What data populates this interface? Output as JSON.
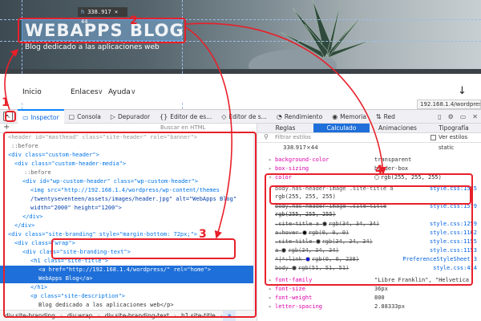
{
  "page": {
    "site_title": "WEBAPPS BLOG",
    "site_description": "Blog dedicado a las aplicaciones web",
    "dim_tooltip_tag": "h",
    "dim_tooltip_size": "338.917 × 44",
    "nav": [
      "Inicio",
      "Enlaces",
      "Ayuda"
    ],
    "nav_chevron": "∨",
    "scroll_down_arrow": "↓",
    "url_tooltip": "192.168.1.4/wordpress/"
  },
  "devtools": {
    "tabs": [
      {
        "label": "Inspector",
        "icon": "inspector-icon"
      },
      {
        "label": "Consola",
        "icon": "console-icon"
      },
      {
        "label": "Depurador",
        "icon": "debugger-icon"
      },
      {
        "label": "Editor de es...",
        "icon": "style-editor-icon"
      },
      {
        "label": "Editor de s...",
        "icon": "shader-editor-icon"
      },
      {
        "label": "Rendimiento",
        "icon": "performance-icon"
      },
      {
        "label": "Memoria",
        "icon": "memory-icon"
      },
      {
        "label": "Red",
        "icon": "network-icon"
      }
    ],
    "search_placeholder": "Buscar en HTML",
    "markup_lines": [
      "<header id=\"masthead\" class=\"site-header\" role=\"banner\">",
      "::before",
      "<div class=\"custom-header\">",
      "<div class=\"custom-header-media\">",
      "::before",
      "<div id=\"wp-custom-header\" class=\"wp-custom-header\">",
      "<img src=\"http://192.168.1.4/wordpress/wp-content/themes",
      "/twentyseventeen/assets/images/header.jpg\" alt=\"WebApps Blog\"",
      "width=\"2000\" height=\"1200\">",
      "</div>",
      "</div>",
      "<div class=\"site-branding\" style=\"margin-bottom: 72px;\">",
      "<div class=\"wrap\">",
      "<div class=\"site-branding-text\">",
      "<h1 class=\"site-title\">",
      "<a href=\"http://192.168.1.4/wordpress/\" rel=\"home\">",
      "WebApps Blog</a>",
      "</h1>",
      "<p class=\"site-description\">",
      "Blog dedicado a las aplicaciones web</p>",
      "</div>",
      "<!--.site-branding-text-->",
      "</div>"
    ],
    "breadcrumbs": [
      "div.site-branding",
      "div.wrap",
      "div.site-branding-text",
      "h1.site-title",
      "a"
    ],
    "right_tabs": [
      "Reglas",
      "Calculado",
      "Animaciones",
      "Tipografía"
    ],
    "filter_placeholder": "Filtrar estilos",
    "browser_styles_label": "Ver estilos",
    "box_size": "338.917×44",
    "box_position": "static",
    "computed": [
      {
        "name": "background-color",
        "value": "transparent"
      },
      {
        "name": "box-sizing",
        "value": "border-box"
      },
      {
        "name": "color",
        "value": "rgb(255, 255, 255)"
      }
    ],
    "color_rules": [
      {
        "selector": "body.has-header-image .site-title a",
        "source": "style.css:1585",
        "value": "rgb(255, 255, 255)"
      },
      {
        "selector": "body.has-header-image .site-title",
        "source": "style.css:1579",
        "value": "rgb(255, 255, 255)"
      },
      {
        "selector": ".site-title a",
        "source": "style.css:1259",
        "value": "rgb(34, 34, 34)"
      },
      {
        "selector": "a:hover",
        "source": "style.css:1162",
        "value": "rgb(0, 0, 0)"
      },
      {
        "selector": ".site-title",
        "source": "style.css:1155",
        "value": "rgb(34, 34, 34)"
      },
      {
        "selector": "a",
        "source": "style.css:1153",
        "value": "rgb(34, 34, 34)"
      },
      {
        "selector": "*|*:link",
        "source": "PreferenceStyleSheet:3",
        "value": "rgb(0, 0, 238)"
      },
      {
        "selector": "body",
        "source": "style.css:414",
        "value": "rgb(51, 51, 51)"
      }
    ],
    "computed_more": [
      {
        "name": "font-family",
        "value": "\"Libre Franklin\", \"Helvetica"
      },
      {
        "name": "font-size",
        "value": "36px"
      },
      {
        "name": "font-weight",
        "value": "800"
      },
      {
        "name": "letter-spacing",
        "value": "2.88333px"
      }
    ]
  },
  "annotations": [
    "1",
    "2",
    "3",
    "4"
  ],
  "colors": {
    "accent": "#1e6fd9",
    "annotation": "#e8202a",
    "selector": "#dd00a9"
  }
}
